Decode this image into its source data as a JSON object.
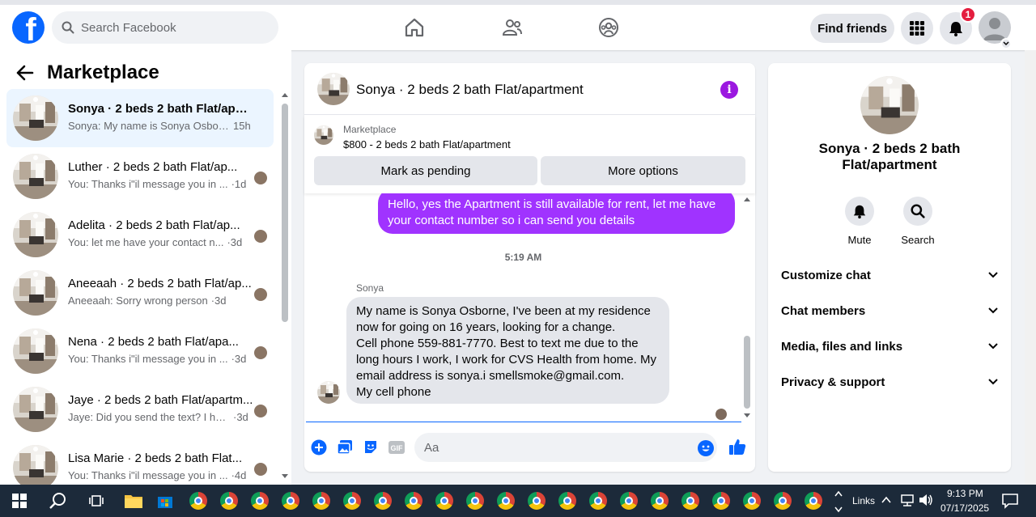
{
  "topbar": {
    "search_placeholder": "Search Facebook",
    "find_friends_label": "Find friends",
    "notification_count": "1"
  },
  "left": {
    "title": "Marketplace",
    "conversations": [
      {
        "name": "Sonya · 2 beds 2 bath Flat/apart...",
        "snippet": "Sonya: My name is Sonya Osborn...",
        "time": "15h",
        "active": true
      },
      {
        "name": "Luther · 2 beds 2 bath Flat/ap...",
        "snippet": "You: Thanks i\"il message you in ...",
        "time": "·1d"
      },
      {
        "name": "Adelita · 2 beds 2 bath Flat/ap...",
        "snippet": "You: let me have your contact n...",
        "time": "·3d"
      },
      {
        "name": "Aneeaah · 2 beds 2 bath Flat/ap...",
        "snippet": "Aneeaah: Sorry wrong person",
        "time": "·3d"
      },
      {
        "name": "Nena · 2 beds 2 bath Flat/apa...",
        "snippet": "You: Thanks i\"il message you in ...",
        "time": "·3d"
      },
      {
        "name": "Jaye · 2 beds 2 bath Flat/apartm...",
        "snippet": "Jaye: Did you send the text? I have...",
        "time": "·3d"
      },
      {
        "name": "Lisa Marie · 2 beds 2 bath Flat...",
        "snippet": "You: Thanks i\"il message you in ...",
        "time": "·4d"
      }
    ]
  },
  "chat": {
    "header_name": "Sonya · 2 beds 2 bath Flat/apartment",
    "marketplace_label": "Marketplace",
    "listing": "$800 - 2 beds 2 bath Flat/apartment",
    "mark_pending_label": "Mark as pending",
    "more_options_label": "More options",
    "outgoing_message": "Hello, yes the Apartment is still available for rent, let me have your contact number so i can send you details",
    "timestamp": "5:19 AM",
    "sender_name": "Sonya",
    "incoming_message": "My name is Sonya Osborne, I've been at my residence now for going on 16 years, looking for a change.\nCell phone 559-881-7770. Best to text me due to the long hours I work, I work for CVS Health from home. My email address is sonya.i smellsmoke@gmail.com.\nMy cell phone",
    "input_placeholder": "Aa"
  },
  "right": {
    "name": "Sonya · 2 beds 2 bath Flat/apartment",
    "mute_label": "Mute",
    "search_label": "Search",
    "sections": [
      "Customize chat",
      "Chat members",
      "Media, files and links",
      "Privacy & support"
    ]
  },
  "taskbar": {
    "links_label": "Links",
    "time": "9:13 PM",
    "date": "07/17/2025"
  },
  "colors": {
    "brand": "#0866ff",
    "outgoing_bubble": "#a033ff",
    "info_icon": "#9b18e0",
    "badge": "#e41e3f"
  }
}
